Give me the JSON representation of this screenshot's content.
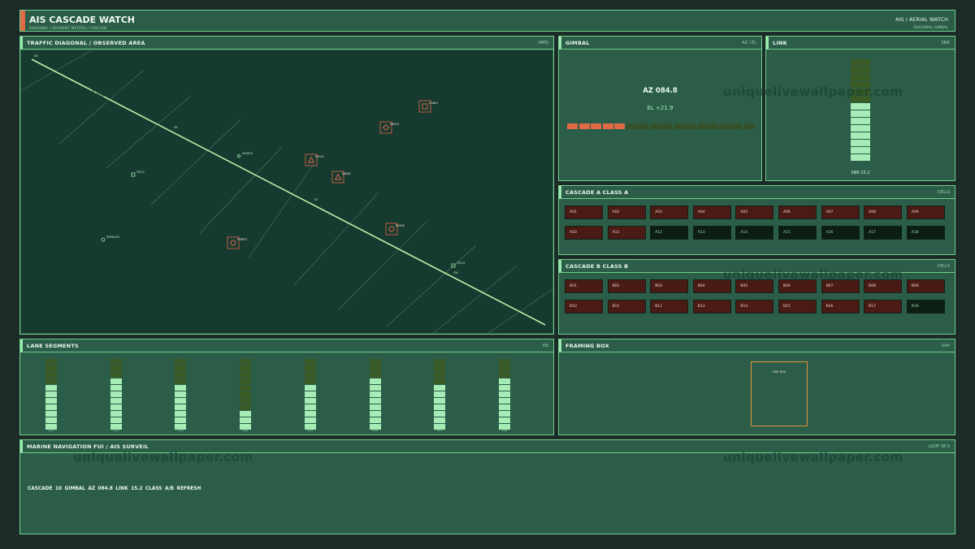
{
  "header": {
    "title": "AIS CASCADE WATCH",
    "subtitle": "DIAGONAL  /  SEGMENT METERS  /  CASCADE",
    "right_title": "AIS  /  AERIAL WATCH",
    "right_sub": "DIAGONAL  GIMBAL"
  },
  "traffic": {
    "title": "TRAFFIC DIAGONAL  /  OBSERVED AREA",
    "tag": "HMSI",
    "track_labels": [
      "NE",
      "S6",
      "S3",
      "SW"
    ],
    "targets": [
      {
        "label": "CON01"
      },
      {
        "label": "HBG23"
      },
      {
        "label": "PDG47"
      },
      {
        "label": "NAV84"
      },
      {
        "label": "BUS06"
      },
      {
        "label": "FERR07"
      },
      {
        "label": "FRT12"
      },
      {
        "label": "HARP20"
      },
      {
        "label": "TUG21"
      },
      {
        "label": "DREDG18"
      }
    ],
    "colors": {
      "track": "#b8f0a8",
      "target_hostile": "#e06a45",
      "target_friendly": "#9be8b0"
    }
  },
  "gimbal": {
    "title": "GIMBAL",
    "tag": "AZ / EL",
    "az": "AZ 084.8",
    "el": "EL +21.9",
    "bar_level": 0.31
  },
  "link": {
    "title": "LINK",
    "tag": "SNR",
    "snr_label": "SNR 15.2",
    "level_fraction": 0.57
  },
  "cascade_a": {
    "title": "CASCADE A  CLASS A",
    "tag": "CELLS",
    "cells": [
      {
        "id": "A01",
        "state": "hot"
      },
      {
        "id": "A02",
        "state": "hot"
      },
      {
        "id": "A03",
        "state": "hot"
      },
      {
        "id": "A04",
        "state": "hot"
      },
      {
        "id": "A05",
        "state": "hot"
      },
      {
        "id": "A06",
        "state": "hot"
      },
      {
        "id": "A07",
        "state": "hot"
      },
      {
        "id": "A08",
        "state": "hot"
      },
      {
        "id": "A09",
        "state": "hot"
      },
      {
        "id": "A10",
        "state": "hot"
      },
      {
        "id": "A11",
        "state": "hot"
      },
      {
        "id": "A12",
        "state": "dark"
      },
      {
        "id": "A13",
        "state": "dark"
      },
      {
        "id": "A14",
        "state": "dark"
      },
      {
        "id": "A15",
        "state": "dark"
      },
      {
        "id": "A16",
        "state": "dark"
      },
      {
        "id": "A17",
        "state": "dark"
      },
      {
        "id": "A18",
        "state": "dark"
      }
    ]
  },
  "cascade_b": {
    "title": "CASCADE B  CLASS B",
    "tag": "CELLS",
    "cells": [
      {
        "id": "B01",
        "state": "hot"
      },
      {
        "id": "B02",
        "state": "hot"
      },
      {
        "id": "B03",
        "state": "hot"
      },
      {
        "id": "B04",
        "state": "hot"
      },
      {
        "id": "B05",
        "state": "hot"
      },
      {
        "id": "B06",
        "state": "hot"
      },
      {
        "id": "B07",
        "state": "hot"
      },
      {
        "id": "B08",
        "state": "hot"
      },
      {
        "id": "B09",
        "state": "hot"
      },
      {
        "id": "B10",
        "state": "hot"
      },
      {
        "id": "B11",
        "state": "hot"
      },
      {
        "id": "B12",
        "state": "hot"
      },
      {
        "id": "B13",
        "state": "hot"
      },
      {
        "id": "B14",
        "state": "hot"
      },
      {
        "id": "B15",
        "state": "hot"
      },
      {
        "id": "B16",
        "state": "hot"
      },
      {
        "id": "B17",
        "state": "hot"
      },
      {
        "id": "B18",
        "state": "dark"
      }
    ]
  },
  "lanes": {
    "title": "LANE SEGMENTS",
    "tag": "EN",
    "segments": [
      {
        "label": "L01",
        "lit": 7
      },
      {
        "label": "L02",
        "lit": 8
      },
      {
        "label": "L03",
        "lit": 7
      },
      {
        "label": "L04",
        "lit": 3
      },
      {
        "label": "L05",
        "lit": 7
      },
      {
        "label": "L06",
        "lit": 8
      },
      {
        "label": "L07",
        "lit": 7
      },
      {
        "label": "L08",
        "lit": 8
      }
    ],
    "total_cells": 11
  },
  "framing": {
    "title": "FRAMING BOX",
    "tag": "UAV",
    "box_label": "OBS BOX"
  },
  "bottom": {
    "title": "MARINE NAVIGATION FUI  /  AIS SURVEIL",
    "tag": "LOOP 38 S",
    "ticker": "CASCADE 10  GIMBAL AZ 084.8  LINK 15.2  CLASS A/B REFRESH"
  },
  "watermark": "uniquelivewallpaper.com"
}
